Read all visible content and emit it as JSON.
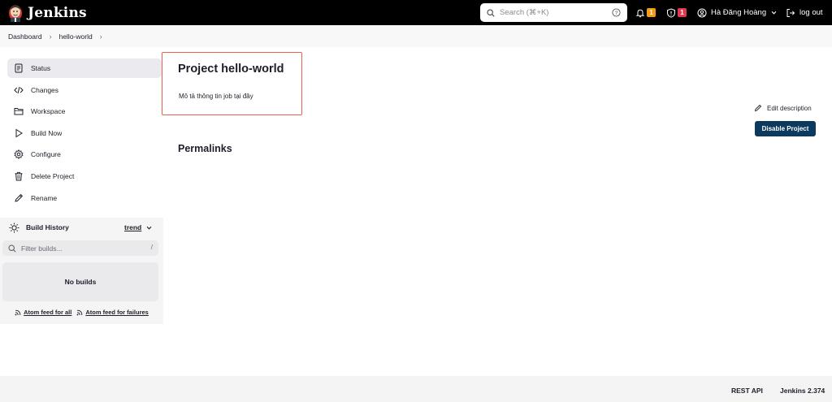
{
  "header": {
    "brand": "Jenkins",
    "search_placeholder": "Search (⌘+K)",
    "notifications_count": "1",
    "security_count": "1",
    "user_name": "Hà Đăng Hoàng",
    "logout_label": "log out"
  },
  "breadcrumb": {
    "items": [
      "Dashboard",
      "hello-world"
    ]
  },
  "sidebar": {
    "items": [
      {
        "label": "Status",
        "icon": "document-icon"
      },
      {
        "label": "Changes",
        "icon": "code-icon"
      },
      {
        "label": "Workspace",
        "icon": "folder-icon"
      },
      {
        "label": "Build Now",
        "icon": "play-icon"
      },
      {
        "label": "Configure",
        "icon": "gear-icon"
      },
      {
        "label": "Delete Project",
        "icon": "trash-icon"
      },
      {
        "label": "Rename",
        "icon": "pencil-icon"
      }
    ]
  },
  "build_history": {
    "title": "Build History",
    "trend_label": "trend",
    "filter_placeholder": "Filter builds...",
    "filter_shortcut": "/",
    "empty_label": "No builds",
    "feed_all": "Atom feed for all",
    "feed_failures": "Atom feed for failures"
  },
  "main": {
    "title": "Project hello-world",
    "description": "Mô tả thông tin job tại đây",
    "permalinks_heading": "Permalinks",
    "edit_description_label": "Edit description",
    "disable_button_label": "Disable Project"
  },
  "footer": {
    "rest_api": "REST API",
    "version": "Jenkins 2.374"
  },
  "colors": {
    "header_bg": "#000000",
    "highlight_border": "#e8624a",
    "primary_button": "#0b3a5e",
    "badge_orange": "#f39c12",
    "badge_red": "#e4394d"
  }
}
